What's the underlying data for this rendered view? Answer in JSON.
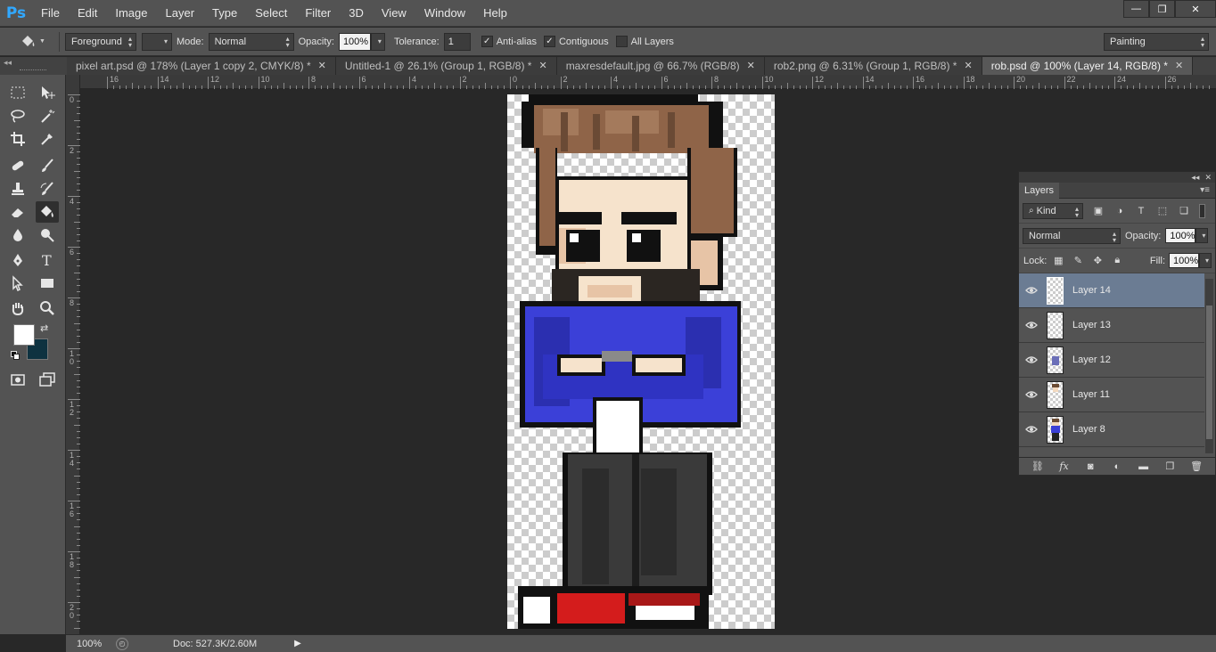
{
  "app": {
    "logo": "Ps"
  },
  "menu": [
    "File",
    "Edit",
    "Image",
    "Layer",
    "Type",
    "Select",
    "Filter",
    "3D",
    "View",
    "Window",
    "Help"
  ],
  "window_controls": {
    "minimize": "—",
    "restore": "❐",
    "close": "✕"
  },
  "options": {
    "fill_source": "Foreground",
    "mode_label": "Mode:",
    "mode_value": "Normal",
    "opacity_label": "Opacity:",
    "opacity_value": "100%",
    "tolerance_label": "Tolerance:",
    "tolerance_value": "1",
    "antialias_label": "Anti-alias",
    "antialias_checked": true,
    "contiguous_label": "Contiguous",
    "contiguous_checked": true,
    "all_layers_label": "All Layers",
    "all_layers_checked": false,
    "workspace": "Painting"
  },
  "tabs": [
    {
      "label": "pixel art.psd @ 178% (Layer 1 copy 2, CMYK/8) *",
      "active": false
    },
    {
      "label": "Untitled-1 @ 26.1% (Group 1, RGB/8) *",
      "active": false
    },
    {
      "label": "maxresdefault.jpg @ 66.7% (RGB/8)",
      "active": false
    },
    {
      "label": "rob2.png @ 6.31% (Group 1, RGB/8) *",
      "active": false
    },
    {
      "label": "rob.psd @ 100% (Layer 14, RGB/8) *",
      "active": true
    }
  ],
  "ruler_top_labels": [
    "16",
    "14",
    "12",
    "10",
    "8",
    "6",
    "4",
    "2",
    "0",
    "2",
    "4",
    "6",
    "8",
    "10",
    "12",
    "14",
    "16",
    "18",
    "20",
    "22",
    "24",
    "26"
  ],
  "ruler_left_labels": [
    "0",
    "2",
    "4",
    "6",
    "8",
    "1\n0",
    "1\n2",
    "1\n4",
    "1\n6",
    "1\n8",
    "2\n0"
  ],
  "colors": {
    "foreground": "#ffffff",
    "background": "#0e3240",
    "layer_selected": "#6b7c93"
  },
  "status": {
    "zoom": "100%",
    "doc": "Doc: 527.3K/2.60M"
  },
  "layers_panel": {
    "title": "Layers",
    "filter_kind": "Kind",
    "blend_mode": "Normal",
    "opacity_label": "Opacity:",
    "opacity_value": "100%",
    "lock_label": "Lock:",
    "fill_label": "Fill:",
    "fill_value": "100%",
    "layers": [
      {
        "name": "Layer 14",
        "selected": true,
        "visible": true
      },
      {
        "name": "Layer 13",
        "selected": false,
        "visible": true
      },
      {
        "name": "Layer 12",
        "selected": false,
        "visible": true
      },
      {
        "name": "Layer 11",
        "selected": false,
        "visible": true
      },
      {
        "name": "Layer 8",
        "selected": false,
        "visible": true
      }
    ]
  }
}
